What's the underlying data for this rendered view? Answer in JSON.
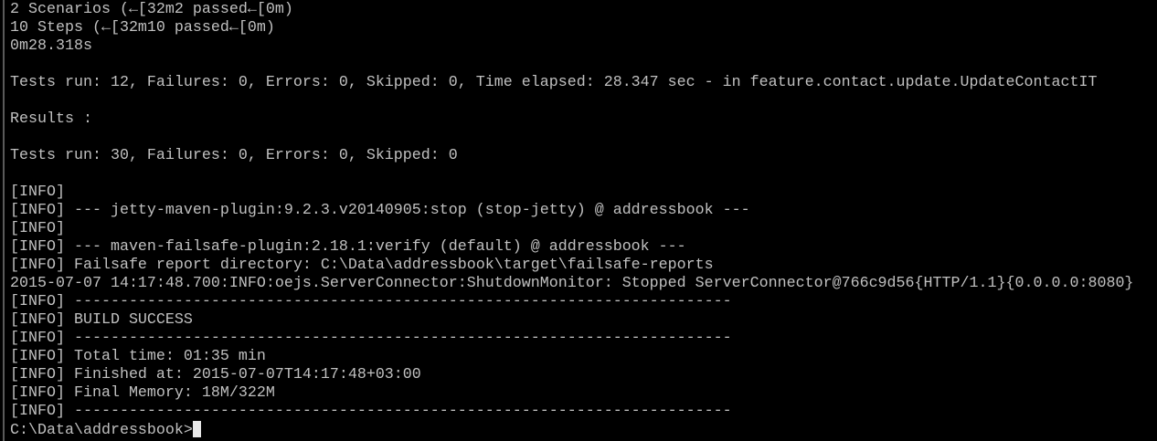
{
  "terminal": {
    "lines": [
      "2 Scenarios (←[32m2 passed←[0m)",
      "10 Steps (←[32m10 passed←[0m)",
      "0m28.318s",
      "",
      "Tests run: 12, Failures: 0, Errors: 0, Skipped: 0, Time elapsed: 28.347 sec - in feature.contact.update.UpdateContactIT",
      "",
      "Results :",
      "",
      "Tests run: 30, Failures: 0, Errors: 0, Skipped: 0",
      "",
      "[INFO]",
      "[INFO] --- jetty-maven-plugin:9.2.3.v20140905:stop (stop-jetty) @ addressbook ---",
      "[INFO]",
      "[INFO] --- maven-failsafe-plugin:2.18.1:verify (default) @ addressbook ---",
      "[INFO] Failsafe report directory: C:\\Data\\addressbook\\target\\failsafe-reports",
      "2015-07-07 14:17:48.700:INFO:oejs.ServerConnector:ShutdownMonitor: Stopped ServerConnector@766c9d56{HTTP/1.1}{0.0.0.0:8080}",
      "[INFO] ------------------------------------------------------------------------",
      "[INFO] BUILD SUCCESS",
      "[INFO] ------------------------------------------------------------------------",
      "[INFO] Total time: 01:35 min",
      "[INFO] Finished at: 2015-07-07T14:17:48+03:00",
      "[INFO] Final Memory: 18M/322M",
      "[INFO] ------------------------------------------------------------------------"
    ],
    "prompt": "C:\\Data\\addressbook>",
    "colors": {
      "background": "#000000",
      "text": "#c0c0c0"
    }
  }
}
